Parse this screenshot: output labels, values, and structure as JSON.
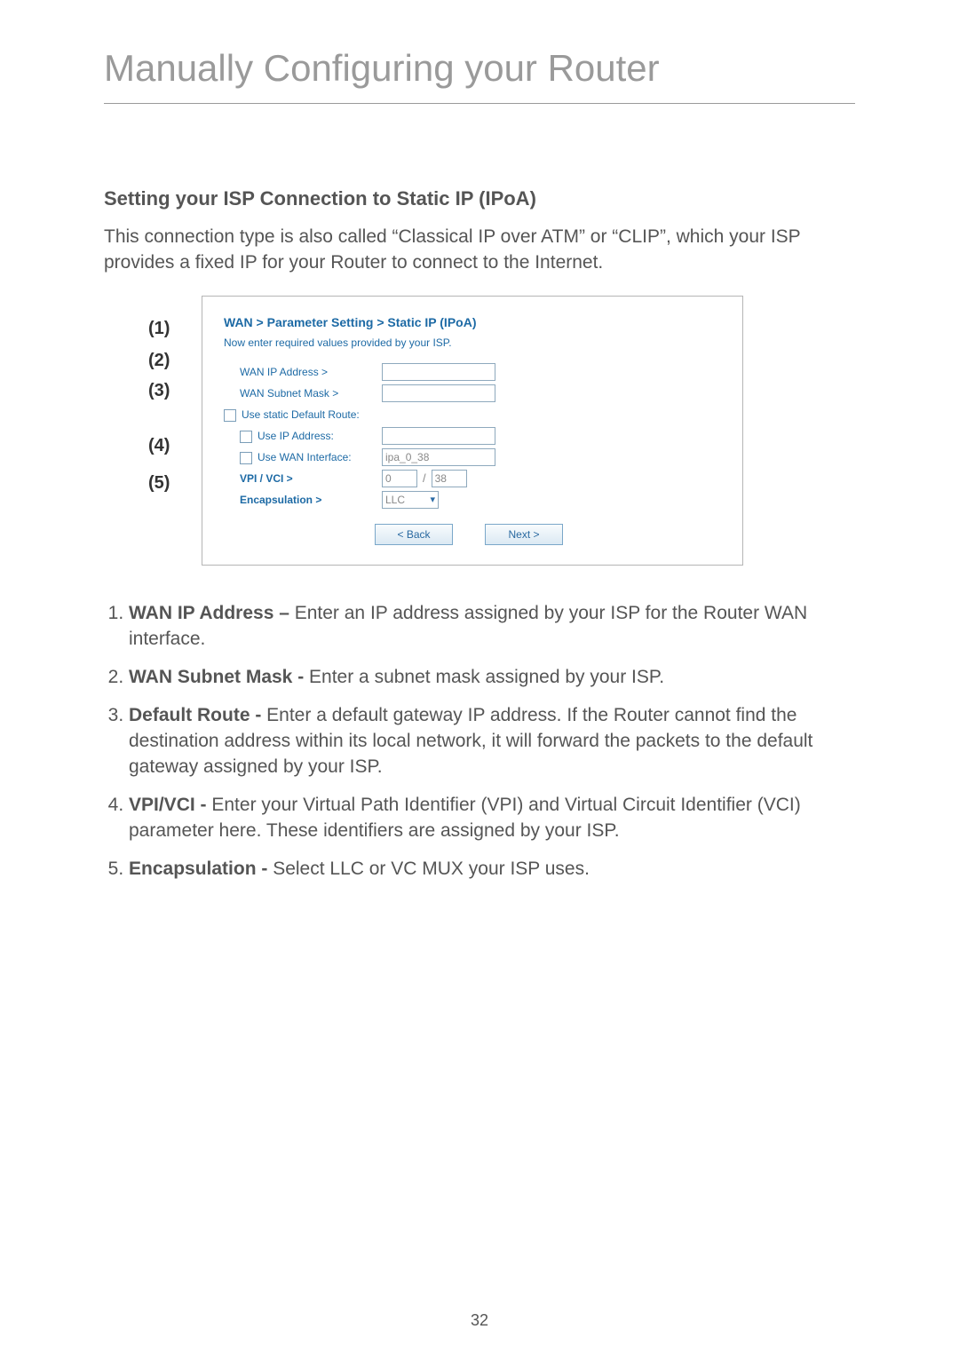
{
  "title": "Manually Configuring your Router",
  "subtitle": "Setting your ISP Connection to Static IP (IPoA)",
  "intro": "This connection type is also called “Classical IP over ATM” or “CLIP”, which your ISP provides a fixed IP for your Router to connect to the Internet.",
  "callouts": [
    "(1)",
    "(2)",
    "(3)",
    "(4)",
    "(5)"
  ],
  "panel": {
    "breadcrumb": "WAN > Parameter Setting > Static IP (IPoA)",
    "instruction": "Now enter required values provided by your ISP.",
    "labels": {
      "wan_ip": "WAN IP Address >",
      "wan_mask": "WAN Subnet Mask >",
      "use_static": "Use static Default Route:",
      "use_ip": "Use IP Address:",
      "use_wan_if": "Use WAN Interface:",
      "vpi_vci": "VPI / VCI >",
      "encap": "Encapsulation >"
    },
    "values": {
      "wan_if": "ipa_0_38",
      "vpi": "0",
      "vci": "38",
      "encap": "LLC"
    },
    "buttons": {
      "back": "< Back",
      "next": "Next >"
    }
  },
  "items": [
    {
      "term": "WAN IP Address –",
      "desc": " Enter an IP address assigned by your ISP for the Router WAN interface."
    },
    {
      "term": "WAN Subnet Mask -",
      "desc": " Enter a subnet mask assigned by your ISP."
    },
    {
      "term": "Default Route -",
      "desc": " Enter a default gateway IP address. If the Router cannot find the destination address within its local network, it will forward the packets to the default gateway assigned by your ISP."
    },
    {
      "term": "VPI/VCI -",
      "desc": " Enter your Virtual Path Identifier (VPI) and Virtual Circuit Identifier (VCI) parameter here. These identifiers are assigned by your ISP."
    },
    {
      "term": "Encapsulation -",
      "desc": " Select LLC or VC MUX your ISP uses."
    }
  ],
  "page_number": "32"
}
